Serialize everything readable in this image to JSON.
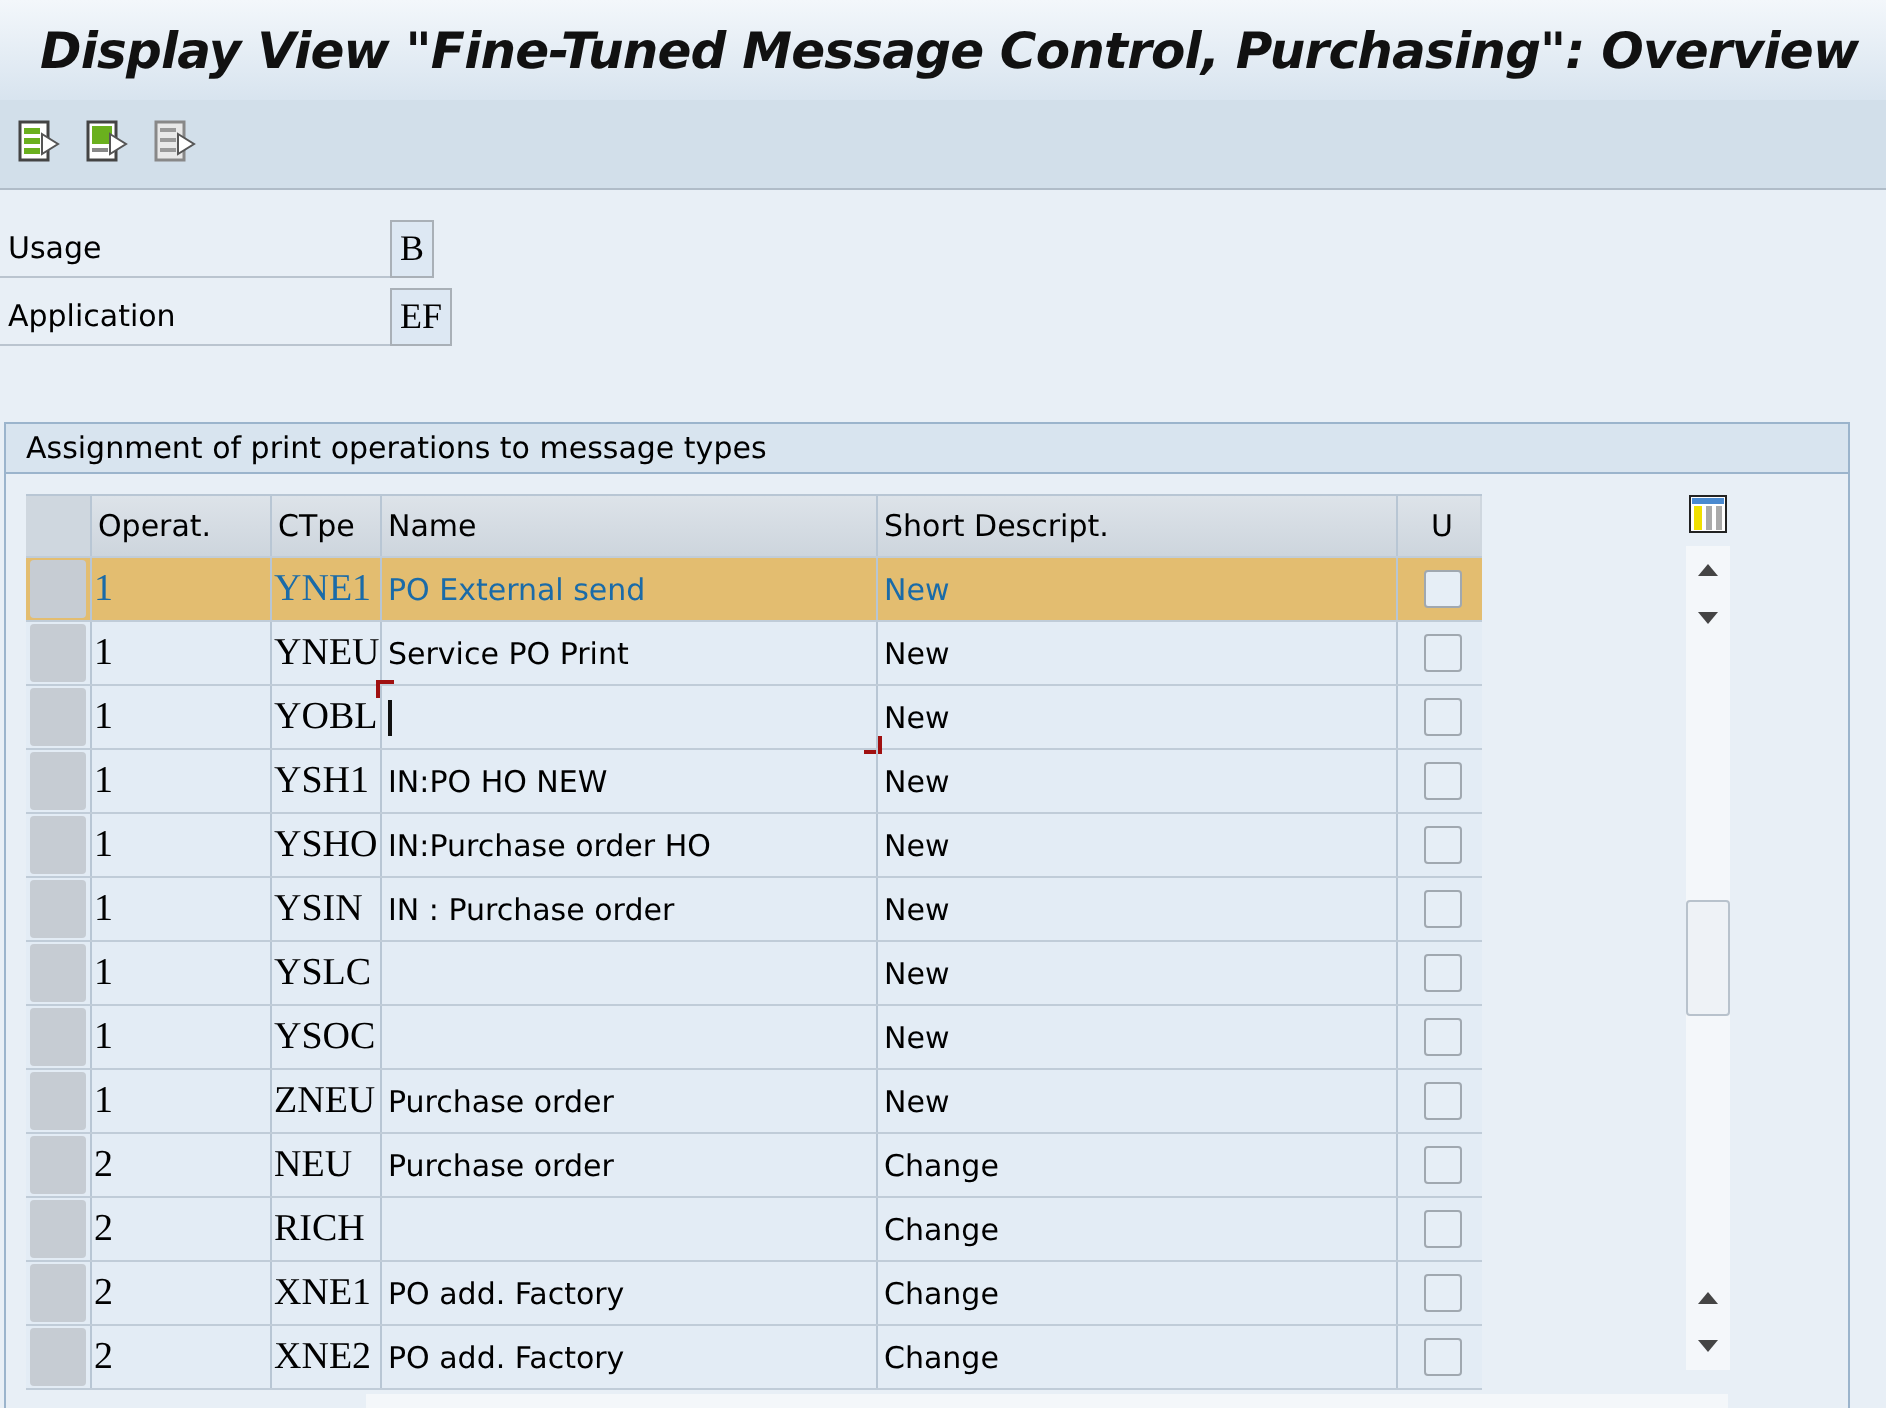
{
  "window": {
    "title": "Display View \"Fine-Tuned Message Control, Purchasing\": Overview"
  },
  "fields": [
    {
      "label": "Usage",
      "value": "B"
    },
    {
      "label": "Application",
      "value": "EF"
    }
  ],
  "table": {
    "title": "Assignment of print operations to message types",
    "columns": [
      "Operat.",
      "CTpe",
      "Name",
      "Short Descript.",
      "U"
    ],
    "rows": [
      {
        "operat": "1",
        "ctpe": "YNE1",
        "name": "PO External send",
        "short": "New",
        "u": false,
        "selected": true,
        "focused": false
      },
      {
        "operat": "1",
        "ctpe": "YNEU",
        "name": "Service PO Print",
        "short": "New",
        "u": false,
        "selected": false,
        "focused": false
      },
      {
        "operat": "1",
        "ctpe": "YOBL",
        "name": "",
        "short": "New",
        "u": false,
        "selected": false,
        "focused": true
      },
      {
        "operat": "1",
        "ctpe": "YSH1",
        "name": "IN:PO HO NEW",
        "short": "New",
        "u": false,
        "selected": false,
        "focused": false
      },
      {
        "operat": "1",
        "ctpe": "YSHO",
        "name": "IN:Purchase order HO",
        "short": "New",
        "u": false,
        "selected": false,
        "focused": false
      },
      {
        "operat": "1",
        "ctpe": "YSIN",
        "name": "IN : Purchase order",
        "short": "New",
        "u": false,
        "selected": false,
        "focused": false
      },
      {
        "operat": "1",
        "ctpe": "YSLC",
        "name": "",
        "short": "New",
        "u": false,
        "selected": false,
        "focused": false
      },
      {
        "operat": "1",
        "ctpe": "YSOC",
        "name": "",
        "short": "New",
        "u": false,
        "selected": false,
        "focused": false
      },
      {
        "operat": "1",
        "ctpe": "ZNEU",
        "name": "Purchase order",
        "short": "New",
        "u": false,
        "selected": false,
        "focused": false
      },
      {
        "operat": "2",
        "ctpe": "NEU",
        "name": "Purchase order",
        "short": "Change",
        "u": false,
        "selected": false,
        "focused": false
      },
      {
        "operat": "2",
        "ctpe": "RICH",
        "name": "",
        "short": "Change",
        "u": false,
        "selected": false,
        "focused": false
      },
      {
        "operat": "2",
        "ctpe": "XNE1",
        "name": "PO add. Factory",
        "short": "Change",
        "u": false,
        "selected": false,
        "focused": false
      },
      {
        "operat": "2",
        "ctpe": "XNE2",
        "name": "PO add. Factory",
        "short": "Change",
        "u": false,
        "selected": false,
        "focused": false
      }
    ]
  }
}
